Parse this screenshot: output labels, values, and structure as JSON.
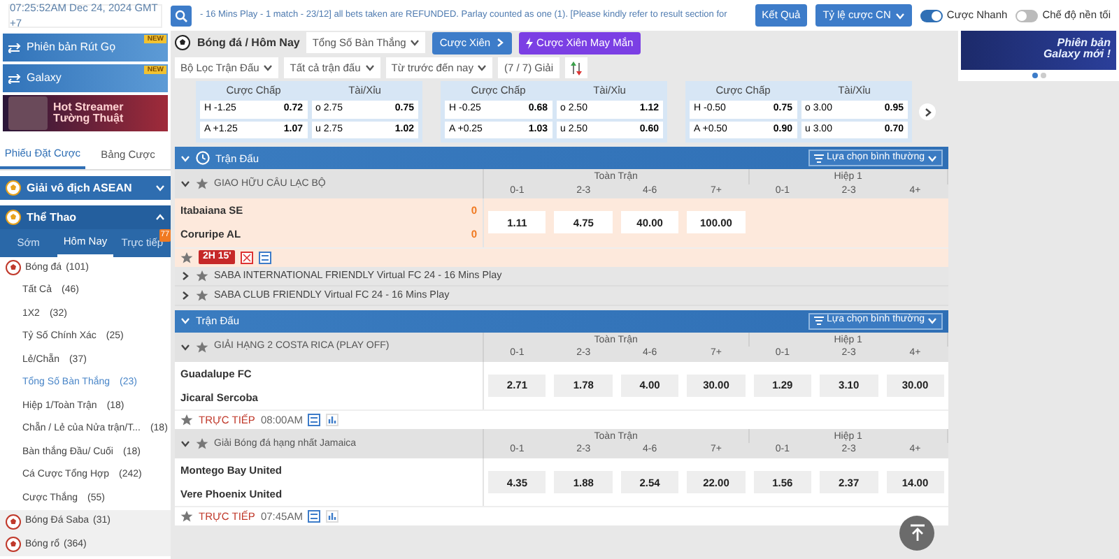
{
  "top_bar": {
    "time": "07:25:52AM Dec 24, 2024 GMT +7",
    "ticker": "- 16 Mins Play - 1 match - 23/12] all bets taken are REFUNDED. Parlay counted as one (1). [Please kindly refer to result section for",
    "results_button": "Kết Quả",
    "odds_dropdown": "Tỷ lệ cược CN",
    "toggles": [
      {
        "label": "Cược Nhanh",
        "on": true
      },
      {
        "label": "Chế độ nền tối",
        "on": false
      }
    ]
  },
  "sidebar": {
    "banners": [
      {
        "kind": "link",
        "label": "Phiên bản Rút Gọ",
        "ribbon": "NEW"
      },
      {
        "kind": "link",
        "label": "Galaxy",
        "ribbon": "NEW"
      },
      {
        "kind": "promo",
        "label": "Hot Streamer",
        "sublabel": "Tường Thuật"
      }
    ],
    "tabs": [
      {
        "label": "Phiếu Đặt Cược",
        "selected": true
      },
      {
        "label": "Bảng Cược",
        "selected": false
      }
    ],
    "groups": [
      {
        "title": "Giải vô địch ASEAN",
        "expanded": false
      },
      {
        "title": "Thể Thao",
        "expanded": true
      }
    ],
    "sub_tabs": [
      {
        "label": "Sớm",
        "selected": false
      },
      {
        "label": "Hôm Nay",
        "selected": true
      },
      {
        "label": "Trực tiếp",
        "selected": false,
        "badge": "77"
      }
    ],
    "sports": [
      {
        "label": "Bóng đá",
        "count": "(101)",
        "expanded": true,
        "children": [
          {
            "label": "Tất Cả",
            "count": "(46)",
            "selected": false
          },
          {
            "label": "1X2",
            "count": "(32)",
            "selected": false
          },
          {
            "label": "Tỷ Số Chính Xác",
            "count": "(25)",
            "selected": false
          },
          {
            "label": "Lẻ/Chẵn",
            "count": "(37)",
            "selected": false
          },
          {
            "label": "Tổng Số Bàn Thắng",
            "count": "(23)",
            "selected": true
          },
          {
            "label": "Hiệp 1/Toàn Trận",
            "count": "(18)",
            "selected": false
          },
          {
            "label": "Chẵn / Lẻ của Nửa trận/T...",
            "count": "(18)",
            "selected": false
          },
          {
            "label": "Bàn thắng Đầu/ Cuối",
            "count": "(18)",
            "selected": false
          },
          {
            "label": "Cá Cược Tổng Hợp",
            "count": "(242)",
            "selected": false
          },
          {
            "label": "Cược Thắng",
            "count": "(55)",
            "selected": false
          }
        ]
      },
      {
        "label": "Bóng Đá Saba",
        "count": "(31)"
      },
      {
        "label": "Bóng rổ",
        "count": "(364)"
      }
    ]
  },
  "toolbar": {
    "breadcrumb": "Bóng đá / Hôm Nay",
    "market_dropdown": "Tổng Số Bàn Thắng",
    "parlay_button": "Cược Xiên",
    "lucky_parlay_button": "Cược Xiên May Mắn",
    "filters": [
      "Bộ Lọc Trận Đấu",
      "Tất cả trận đấu",
      "Từ trước đến nay"
    ],
    "league_count": "(7 / 7) Giải"
  },
  "promo_banner": {
    "title": "Phiên bản",
    "subtitle": "Galaxy mới !",
    "dots": [
      {
        "selected": true
      },
      {
        "selected": false
      }
    ]
  },
  "odds_cards": [
    {
      "handicap_label": "Cược Chấp",
      "total_label": "Tài/Xỉu",
      "handicap": [
        [
          "H -1.25",
          "0.72"
        ],
        [
          "A +1.25",
          "1.07"
        ]
      ],
      "total": [
        [
          "o 2.75",
          "0.75"
        ],
        [
          "u 2.75",
          "1.02"
        ]
      ]
    },
    {
      "handicap_label": "Cược Chấp",
      "total_label": "Tài/Xỉu",
      "handicap": [
        [
          "H -0.25",
          "0.68"
        ],
        [
          "A +0.25",
          "1.03"
        ]
      ],
      "total": [
        [
          "o 2.50",
          "1.12"
        ],
        [
          "u 2.50",
          "0.60"
        ]
      ]
    },
    {
      "handicap_label": "Cược Chấp",
      "total_label": "Tài/Xỉu",
      "handicap": [
        [
          "H -0.50",
          "0.75"
        ],
        [
          "A +0.50",
          "0.90"
        ]
      ],
      "total": [
        [
          "o 3.00",
          "0.95"
        ],
        [
          "u 3.00",
          "0.70"
        ]
      ]
    }
  ],
  "sections": [
    {
      "title": "Trận Đấu",
      "clock_icon": true,
      "option": "Lựa chọn bình thường",
      "leagues": [
        {
          "name": "GIAO HỮU CÂU LẠC BỘ",
          "expanded": true,
          "periods": [
            {
              "title": "Toàn Trận",
              "columns": [
                "0-1",
                "2-3",
                "4-6",
                "7+"
              ]
            },
            {
              "title": "Hiệp 1",
              "columns": [
                "0-1",
                "2-3",
                "4+"
              ]
            }
          ],
          "matches": [
            {
              "home": "Itabaiana SE",
              "away": "Coruripe AL",
              "home_score": "0",
              "away_score": "0",
              "in_play": true,
              "odds": [
                "1.11",
                "4.75",
                "40.00",
                "100.00"
              ],
              "status": {
                "kind": "timer",
                "text": "2H 15'"
              }
            }
          ]
        },
        {
          "name": "SABA INTERNATIONAL FRIENDLY Virtual FC 24 - 16 Mins Play",
          "expanded": false
        },
        {
          "name": "SABA CLUB FRIENDLY Virtual FC 24 - 16 Mins Play",
          "expanded": false
        }
      ]
    },
    {
      "title": "Trận Đấu",
      "clock_icon": false,
      "option": "Lựa chọn bình thường",
      "leagues": [
        {
          "name": "GIẢI HẠNG 2 COSTA RICA (PLAY OFF)",
          "expanded": true,
          "periods": [
            {
              "title": "Toàn Trận",
              "columns": [
                "0-1",
                "2-3",
                "4-6",
                "7+"
              ]
            },
            {
              "title": "Hiệp 1",
              "columns": [
                "0-1",
                "2-3",
                "4+"
              ]
            }
          ],
          "matches": [
            {
              "home": "Guadalupe FC",
              "away": "Jicaral Sercoba",
              "in_play": false,
              "odds": [
                "2.71",
                "1.78",
                "4.00",
                "30.00",
                "1.29",
                "3.10",
                "30.00"
              ],
              "status": {
                "kind": "live",
                "text": "TRỰC TIẾP",
                "time": "08:00AM"
              }
            }
          ]
        },
        {
          "name": "Giải Bóng đá hạng nhất Jamaica",
          "expanded": true,
          "periods": [
            {
              "title": "Toàn Trận",
              "columns": [
                "0-1",
                "2-3",
                "4-6",
                "7+"
              ]
            },
            {
              "title": "Hiệp 1",
              "columns": [
                "0-1",
                "2-3",
                "4+"
              ]
            }
          ],
          "matches": [
            {
              "home": "Montego Bay United",
              "away": "Vere Phoenix United",
              "in_play": false,
              "odds": [
                "4.35",
                "1.88",
                "2.54",
                "22.00",
                "1.56",
                "2.37",
                "14.00"
              ],
              "status": {
                "kind": "live",
                "text": "TRỰC TIẾP",
                "time": "07:45AM"
              }
            }
          ]
        }
      ]
    }
  ]
}
